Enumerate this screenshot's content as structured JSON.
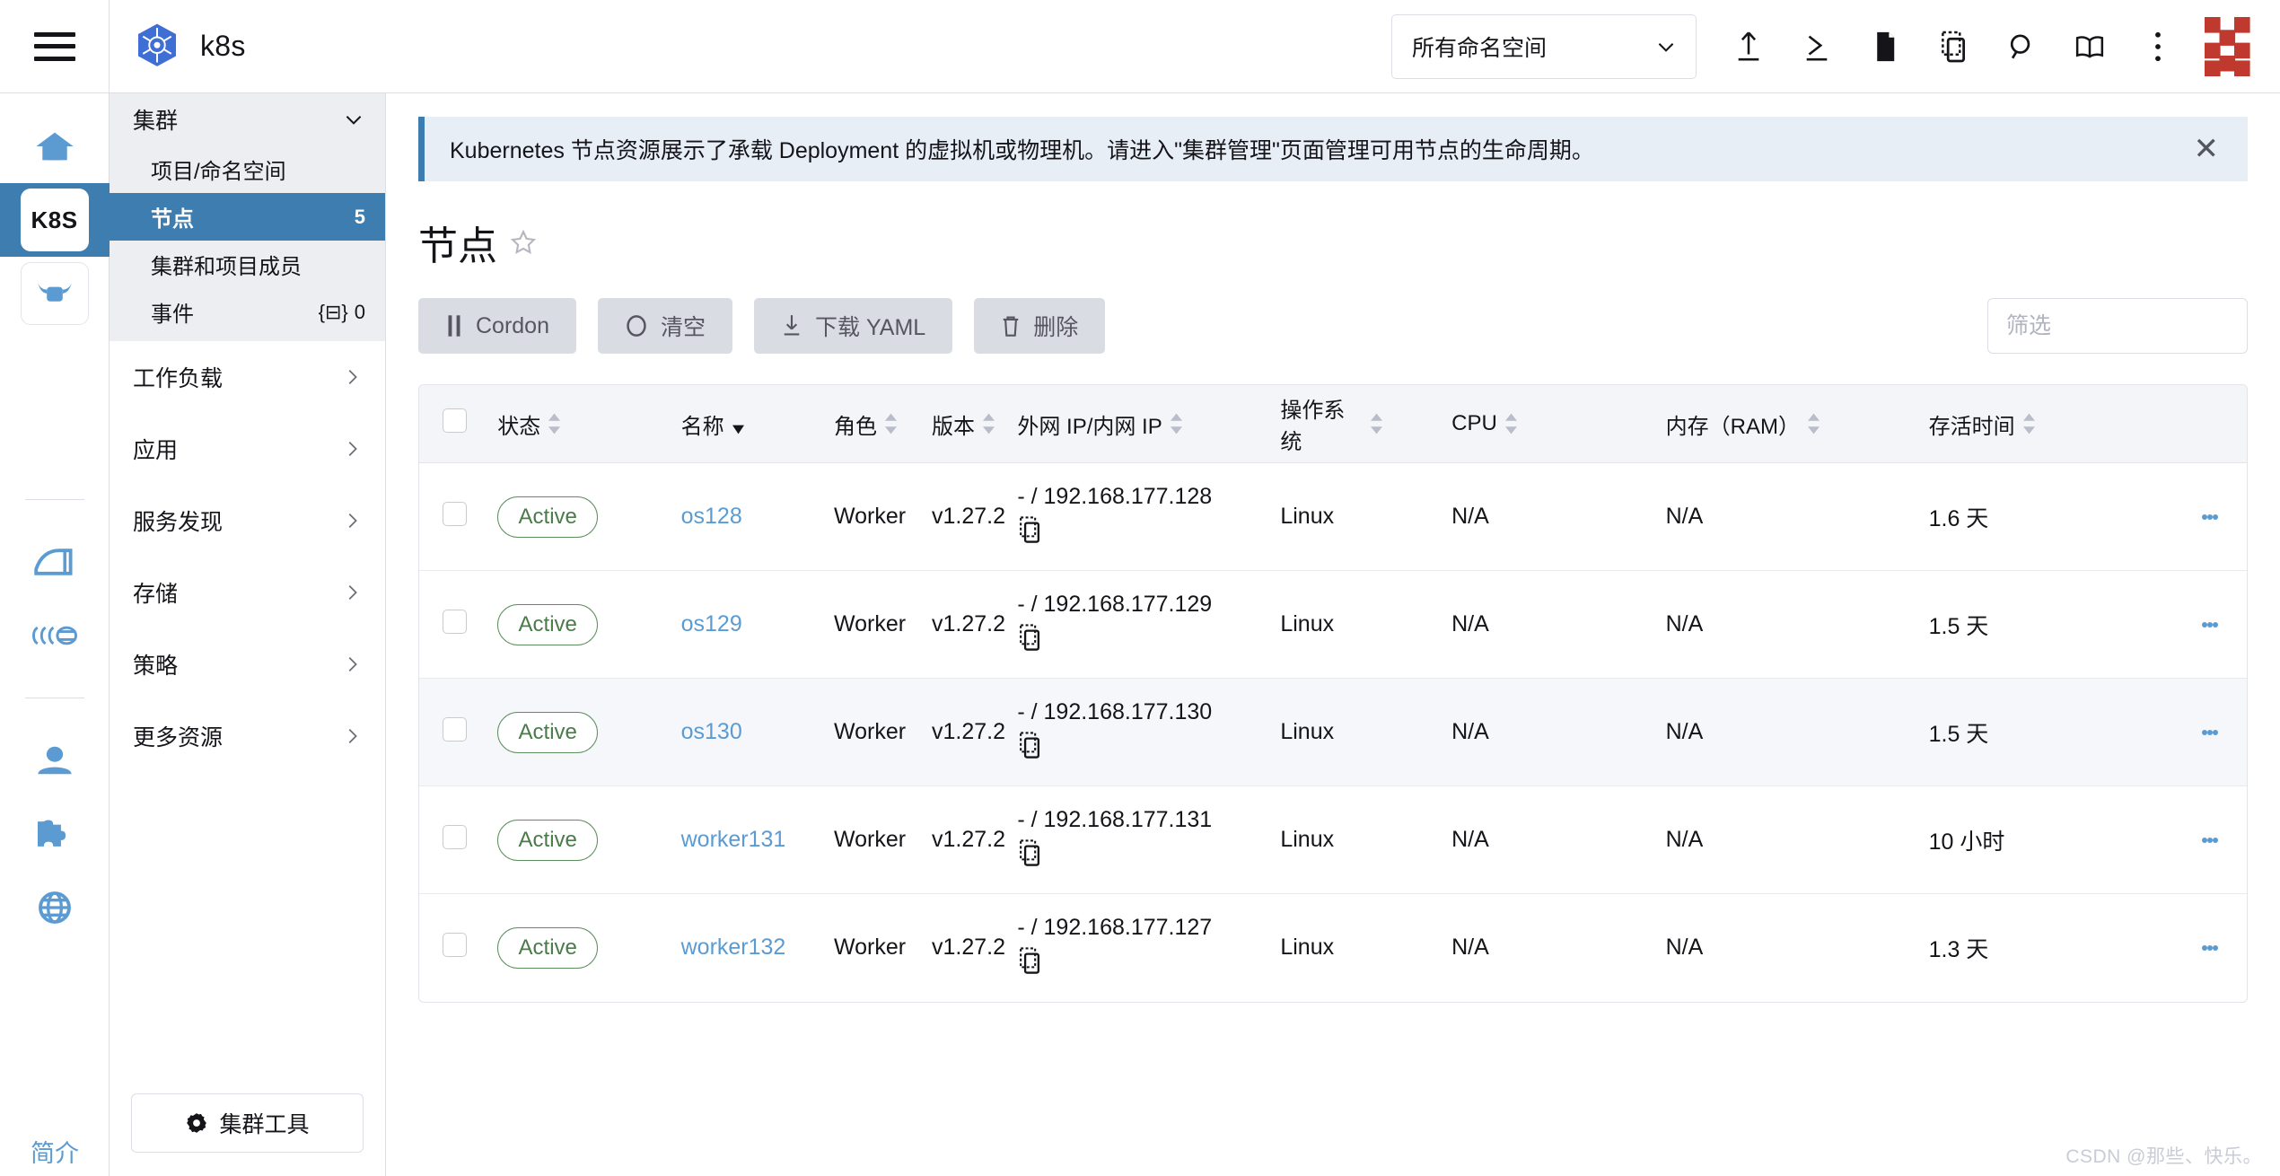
{
  "topbar": {
    "brand_name": "k8s",
    "namespace_selector": {
      "value": "所有命名空间"
    },
    "icons": [
      {
        "name": "import-yaml-icon",
        "title": "导入 YAML"
      },
      {
        "name": "kubectl-shell-icon",
        "title": "Kubectl Shell"
      },
      {
        "name": "file-icon",
        "title": "文件"
      },
      {
        "name": "copy-kubeconfig-icon",
        "title": "复制 KubeConfig"
      },
      {
        "name": "search-icon",
        "title": "搜索"
      },
      {
        "name": "docs-book-icon",
        "title": "文档"
      },
      {
        "name": "overflow-menu-icon",
        "title": "更多"
      }
    ]
  },
  "rail": {
    "items": [
      {
        "name": "home-icon",
        "label": ""
      },
      {
        "name": "cluster-k8s-badge",
        "label": "K8S"
      },
      {
        "name": "cattle-icon",
        "label": ""
      },
      {
        "name": "barn-icon",
        "label": ""
      },
      {
        "name": "fleet-icon",
        "label": ""
      },
      {
        "name": "user-icon",
        "label": ""
      },
      {
        "name": "extension-icon",
        "label": ""
      },
      {
        "name": "globe-icon",
        "label": ""
      }
    ],
    "bottom_label": "简介"
  },
  "sidebar": {
    "group": {
      "label": "集群"
    },
    "sub_items": [
      {
        "label": "项目/命名空间",
        "count": "",
        "selected": false
      },
      {
        "label": "节点",
        "count": "5",
        "selected": true
      },
      {
        "label": "集群和项目成员",
        "count": "",
        "selected": false
      },
      {
        "label": "事件",
        "count": "0",
        "count_prefix": "{⊟}",
        "selected": false
      }
    ],
    "rows": [
      {
        "label": "工作负载"
      },
      {
        "label": "应用"
      },
      {
        "label": "服务发现"
      },
      {
        "label": "存储"
      },
      {
        "label": "策略"
      },
      {
        "label": "更多资源"
      }
    ],
    "tools_button": "集群工具"
  },
  "banner": {
    "text": "Kubernetes 节点资源展示了承载 Deployment 的虚拟机或物理机。请进入\"集群管理\"页面管理可用节点的生命周期。",
    "close_label": "✕"
  },
  "page": {
    "title": "节点"
  },
  "actions": [
    {
      "label": "Cordon",
      "icon": "pause-icon"
    },
    {
      "label": "清空",
      "icon": "drain-circle-icon"
    },
    {
      "label": "下载 YAML",
      "icon": "download-icon"
    },
    {
      "label": "删除",
      "icon": "trash-icon"
    }
  ],
  "filter": {
    "placeholder": "筛选",
    "value": ""
  },
  "table": {
    "columns": [
      {
        "key": "state",
        "label": "状态",
        "sort": "none"
      },
      {
        "key": "name",
        "label": "名称",
        "sort": "desc"
      },
      {
        "key": "role",
        "label": "角色",
        "sort": "none"
      },
      {
        "key": "version",
        "label": "版本",
        "sort": "none"
      },
      {
        "key": "ip",
        "label": "外网 IP/内网 IP",
        "sort": "none"
      },
      {
        "key": "os",
        "label": "操作系统",
        "sort": "none"
      },
      {
        "key": "cpu",
        "label": "CPU",
        "sort": "none"
      },
      {
        "key": "ram",
        "label": "内存（RAM）",
        "sort": "none"
      },
      {
        "key": "age",
        "label": "存活时间",
        "sort": "none"
      }
    ],
    "rows": [
      {
        "state": "Active",
        "name": "os128",
        "role": "Worker",
        "version": "v1.27.2",
        "ip": "- / 192.168.177.128",
        "os": "Linux",
        "cpu": "N/A",
        "ram": "N/A",
        "age": "1.6 天"
      },
      {
        "state": "Active",
        "name": "os129",
        "role": "Worker",
        "version": "v1.27.2",
        "ip": "- / 192.168.177.129",
        "os": "Linux",
        "cpu": "N/A",
        "ram": "N/A",
        "age": "1.5 天"
      },
      {
        "state": "Active",
        "name": "os130",
        "role": "Worker",
        "version": "v1.27.2",
        "ip": "- / 192.168.177.130",
        "os": "Linux",
        "cpu": "N/A",
        "ram": "N/A",
        "age": "1.5 天"
      },
      {
        "state": "Active",
        "name": "worker131",
        "role": "Worker",
        "version": "v1.27.2",
        "ip": "- / 192.168.177.131",
        "os": "Linux",
        "cpu": "N/A",
        "ram": "N/A",
        "age": "10 小时"
      },
      {
        "state": "Active",
        "name": "worker132",
        "role": "Worker",
        "version": "v1.27.2",
        "ip": "- / 192.168.177.127",
        "os": "Linux",
        "cpu": "N/A",
        "ram": "N/A",
        "age": "1.3 天"
      }
    ]
  },
  "watermark": "CSDN @那些、快乐。",
  "colors": {
    "accent_blue": "#3d7daf",
    "link_blue": "#5b9bd1",
    "active_green": "#4b7b4b",
    "banner_bg": "#e8eef6",
    "header_bg": "#f4f5f9",
    "brand_red": "#c0392f"
  }
}
